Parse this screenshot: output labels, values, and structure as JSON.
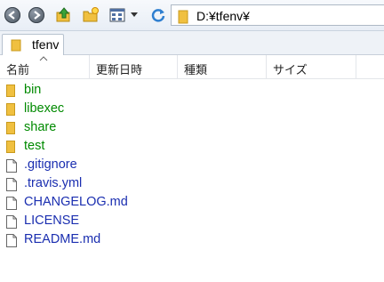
{
  "colors": {
    "folder_name": "#008a00",
    "file_name": "#1a2eb0",
    "folder_icon": "#f0c040"
  },
  "toolbar": {
    "icons": [
      "back-icon",
      "forward-icon",
      "up-folder-icon",
      "new-folder-icon",
      "view-icon",
      "dropdown-icon",
      "refresh-icon"
    ]
  },
  "address": {
    "path": "D:¥tfenv¥"
  },
  "tabs": [
    {
      "label": "tfenv"
    }
  ],
  "columns": [
    {
      "label": "名前"
    },
    {
      "label": "更新日時"
    },
    {
      "label": "種類"
    },
    {
      "label": "サイズ"
    }
  ],
  "items": [
    {
      "name": "bin",
      "type": "folder"
    },
    {
      "name": "libexec",
      "type": "folder"
    },
    {
      "name": "share",
      "type": "folder"
    },
    {
      "name": "test",
      "type": "folder"
    },
    {
      "name": ".gitignore",
      "type": "file"
    },
    {
      "name": ".travis.yml",
      "type": "file"
    },
    {
      "name": "CHANGELOG.md",
      "type": "file"
    },
    {
      "name": "LICENSE",
      "type": "file"
    },
    {
      "name": "README.md",
      "type": "file"
    }
  ]
}
